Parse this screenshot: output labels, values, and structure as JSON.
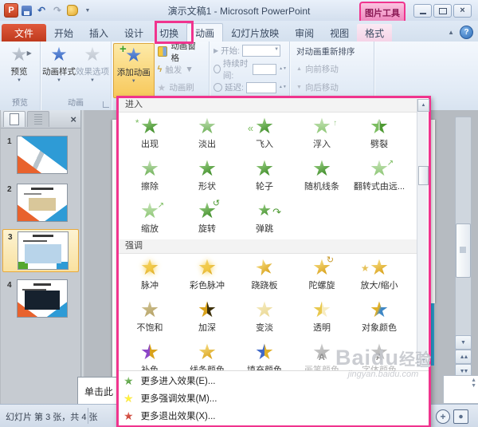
{
  "window": {
    "title": "演示文稿1 - Microsoft PowerPoint",
    "contextual_tab_group": "图片工具"
  },
  "qat": {
    "icons": [
      "powerpoint-icon",
      "save-icon",
      "undo-icon",
      "redo-icon",
      "animation-painter-icon",
      "toolbar-options-icon"
    ]
  },
  "tabs": {
    "file": "文件",
    "items": [
      "开始",
      "插入",
      "设计",
      "切换",
      "动画",
      "幻灯片放映",
      "审阅",
      "视图",
      "格式"
    ],
    "active": "动画",
    "contextual": "格式"
  },
  "ribbon": {
    "preview": {
      "button_label": "预览",
      "group_label": "预览"
    },
    "animation_group": {
      "styles_label": "动画样式",
      "effects_label": "效果选项",
      "group_label": "动画"
    },
    "advanced": {
      "add_label": "添加动画",
      "pane_label": "动画窗格",
      "trigger_label": "触发",
      "painter_label": "动画刷"
    },
    "timing": {
      "start_label": "开始:",
      "duration_label": "持续时间:",
      "delay_label": "延迟:"
    },
    "reorder": {
      "title": "对动画重新排序",
      "earlier_label": "向前移动",
      "later_label": "向后移动"
    }
  },
  "sidebar": {
    "thumbnails": [
      {
        "number": "1",
        "selected": false
      },
      {
        "number": "2",
        "selected": false
      },
      {
        "number": "3",
        "selected": true
      },
      {
        "number": "4",
        "selected": false
      }
    ]
  },
  "slide_fragment": "单击此",
  "statusbar": {
    "text": "幻灯片 第 3 张，共 4 张"
  },
  "gallery": {
    "sections": [
      {
        "title": "进入",
        "items": [
          {
            "label": "出现",
            "icon": "green-star-appear",
            "disabled": false
          },
          {
            "label": "淡出",
            "icon": "green-star-fade",
            "disabled": false
          },
          {
            "label": "飞入",
            "icon": "green-star-fly",
            "disabled": false
          },
          {
            "label": "浮入",
            "icon": "green-star-float",
            "disabled": false
          },
          {
            "label": "劈裂",
            "icon": "green-star-split",
            "disabled": false
          },
          {
            "label": "擦除",
            "icon": "green-star-wipe",
            "disabled": false
          },
          {
            "label": "形状",
            "icon": "green-star-shape",
            "disabled": false
          },
          {
            "label": "轮子",
            "icon": "green-star-wheel",
            "disabled": false
          },
          {
            "label": "随机线条",
            "icon": "green-star-bars",
            "disabled": false
          },
          {
            "label": "翻转式由远...",
            "icon": "green-star-scatter",
            "disabled": false
          },
          {
            "label": "缩放",
            "icon": "green-star-zoom",
            "disabled": false
          },
          {
            "label": "旋转",
            "icon": "green-star-swivel",
            "disabled": false
          },
          {
            "label": "弹跳",
            "icon": "green-star-bounce",
            "disabled": false
          }
        ]
      },
      {
        "title": "强调",
        "items": [
          {
            "label": "脉冲",
            "icon": "gold-star-pulse",
            "disabled": false
          },
          {
            "label": "彩色脉冲",
            "icon": "gold-star-colorpulse",
            "disabled": false
          },
          {
            "label": "跷跷板",
            "icon": "gold-star-teeter",
            "disabled": false
          },
          {
            "label": "陀螺旋",
            "icon": "gold-star-spin",
            "disabled": false
          },
          {
            "label": "放大/缩小",
            "icon": "gold-star-grow",
            "disabled": false
          },
          {
            "label": "不饱和",
            "icon": "tan-star",
            "disabled": false
          },
          {
            "label": "加深",
            "icon": "dark-gold-star",
            "disabled": false
          },
          {
            "label": "变淡",
            "icon": "pale-star",
            "disabled": false
          },
          {
            "label": "透明",
            "icon": "transparent-star",
            "disabled": false
          },
          {
            "label": "对象颜色",
            "icon": "gold-blue-star",
            "disabled": false
          },
          {
            "label": "补色",
            "icon": "purple-gold-star",
            "disabled": false
          },
          {
            "label": "线条颜色",
            "icon": "gold-outline-star",
            "disabled": false
          },
          {
            "label": "填充颜色",
            "icon": "blue-gold-star",
            "disabled": false
          },
          {
            "label": "画笔颜色",
            "icon": "gray-star",
            "disabled": true
          },
          {
            "label": "字体颜色",
            "icon": "gray-star-a",
            "disabled": true
          }
        ]
      }
    ],
    "menu": [
      {
        "label": "更多进入效果(E)...",
        "icon": "green-star"
      },
      {
        "label": "更多强调效果(M)...",
        "icon": "gold-burst-star"
      },
      {
        "label": "更多退出效果(X)...",
        "icon": "red-star"
      }
    ]
  },
  "watermark": {
    "brand": "Baidu",
    "badge": "经验",
    "url": "jingyan.baidu.com"
  },
  "colors": {
    "highlight_pink": "#f0348e",
    "add_button_orange": "#f7c85a",
    "entrance_green": "#3e8d28",
    "emphasis_gold": "#d9a21b",
    "file_tab_red": "#c2401f",
    "selected_thumb_orange": "#e8a93c"
  }
}
